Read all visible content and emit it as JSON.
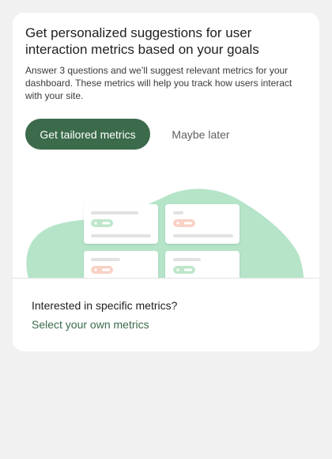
{
  "card": {
    "title": "Get personalized suggestions for user interaction metrics based on your goals",
    "description": "Answer 3 questions and we’ll suggest relevant metrics for your dashboard. These metrics will help you track how users interact with your site.",
    "primary_button": "Get tailored metrics",
    "secondary_button": "Maybe later"
  },
  "footer": {
    "question": "Interested in specific metrics?",
    "link": "Select your own metrics"
  },
  "colors": {
    "accent": "#3b6b4b",
    "illustration_blob": "#b5e4c9",
    "chip_green": "#bfe6cb",
    "chip_red": "#f8d2c6"
  }
}
